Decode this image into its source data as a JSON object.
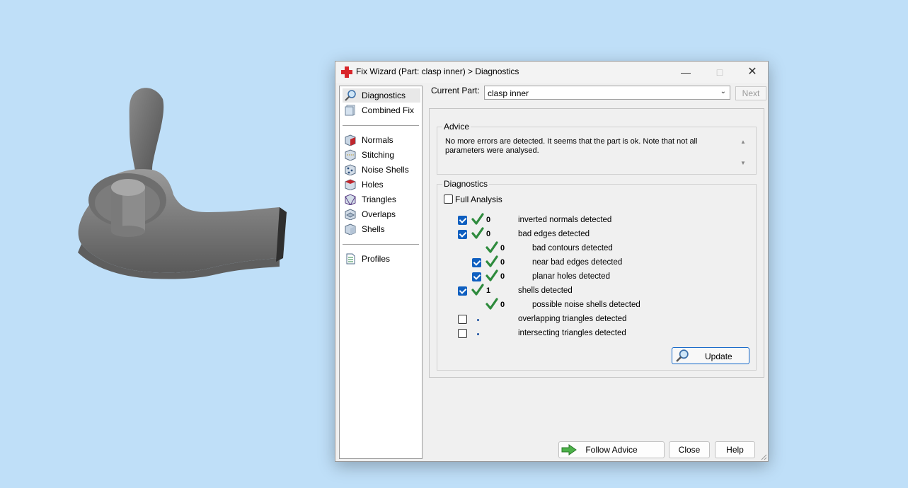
{
  "window": {
    "title": "Fix Wizard (Part: clasp inner) > Diagnostics",
    "minimize_icon": "minimize-icon",
    "maximize_icon": "maximize-icon",
    "close_icon": "close-icon"
  },
  "nav": {
    "top_items": [
      {
        "label": "Diagnostics",
        "icon": "magnifier-icon",
        "selected": true
      },
      {
        "label": "Combined Fix",
        "icon": "combined-fix-icon"
      }
    ],
    "fix_items": [
      {
        "label": "Normals",
        "icon": "normals-icon"
      },
      {
        "label": "Stitching",
        "icon": "stitching-icon"
      },
      {
        "label": "Noise Shells",
        "icon": "noise-shells-icon"
      },
      {
        "label": "Holes",
        "icon": "holes-icon"
      },
      {
        "label": "Triangles",
        "icon": "triangles-icon"
      },
      {
        "label": "Overlaps",
        "icon": "overlaps-icon"
      },
      {
        "label": "Shells",
        "icon": "shells-icon"
      }
    ],
    "bottom_items": [
      {
        "label": "Profiles",
        "icon": "profiles-icon"
      }
    ]
  },
  "current_part": {
    "label": "Current Part:",
    "value": "clasp inner",
    "next_label": "Next"
  },
  "advice": {
    "title": "Advice",
    "text": "No more errors are detected. It seems that the part is ok. Note that not all parameters were analysed."
  },
  "diagnostics": {
    "title": "Diagnostics",
    "full_analysis_label": "Full Analysis",
    "full_analysis_checked": false,
    "rows": [
      {
        "checkbox": true,
        "checked": true,
        "status": "ok",
        "count": "0",
        "label": "inverted normals detected",
        "indent": 0
      },
      {
        "checkbox": true,
        "checked": true,
        "status": "ok",
        "count": "0",
        "label": "bad edges detected",
        "indent": 0
      },
      {
        "checkbox": false,
        "checked": false,
        "status": "ok",
        "count": "0",
        "label": "bad contours detected",
        "indent": 1
      },
      {
        "checkbox": true,
        "checked": true,
        "status": "ok",
        "count": "0",
        "label": "near bad edges detected",
        "indent": 1
      },
      {
        "checkbox": true,
        "checked": true,
        "status": "ok",
        "count": "0",
        "label": "planar holes detected",
        "indent": 1
      },
      {
        "checkbox": true,
        "checked": true,
        "status": "ok",
        "count": "1",
        "label": "shells detected",
        "indent": 0
      },
      {
        "checkbox": false,
        "checked": false,
        "status": "ok",
        "count": "0",
        "label": "possible noise shells detected",
        "indent": 1
      },
      {
        "checkbox": true,
        "checked": false,
        "status": "pending",
        "count": "",
        "label": "overlapping triangles detected",
        "indent": 0
      },
      {
        "checkbox": true,
        "checked": false,
        "status": "pending",
        "count": "",
        "label": "intersecting triangles detected",
        "indent": 0
      }
    ],
    "update_label": "Update"
  },
  "footer": {
    "follow_advice_label": "Follow Advice",
    "close_label": "Close",
    "help_label": "Help"
  },
  "colors": {
    "background": "#bfdff8",
    "accent": "#0f5fc0",
    "check_green": "#2e8b3d"
  }
}
